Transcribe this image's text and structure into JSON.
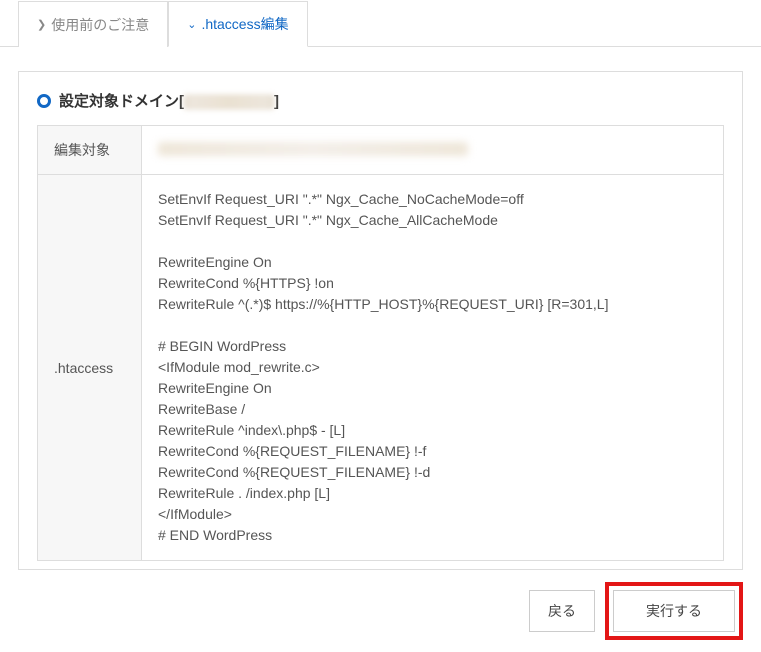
{
  "tabs": {
    "notice": {
      "label": "使用前のご注意"
    },
    "edit": {
      "label": ".htaccess編集"
    }
  },
  "panel": {
    "header_prefix": "設定対象ドメイン[",
    "header_suffix": "]"
  },
  "labels": {
    "target": "編集対象",
    "htaccess": ".htaccess"
  },
  "htaccess_content": "SetEnvIf Request_URI \".*\" Ngx_Cache_NoCacheMode=off\nSetEnvIf Request_URI \".*\" Ngx_Cache_AllCacheMode\n\nRewriteEngine On\nRewriteCond %{HTTPS} !on\nRewriteRule ^(.*)$ https://%{HTTP_HOST}%{REQUEST_URI} [R=301,L]\n\n# BEGIN WordPress\n<IfModule mod_rewrite.c>\nRewriteEngine On\nRewriteBase /\nRewriteRule ^index\\.php$ - [L]\nRewriteCond %{REQUEST_FILENAME} !-f\nRewriteCond %{REQUEST_FILENAME} !-d\nRewriteRule . /index.php [L]\n</IfModule>\n# END WordPress",
  "buttons": {
    "back": "戻る",
    "execute": "実行する"
  }
}
